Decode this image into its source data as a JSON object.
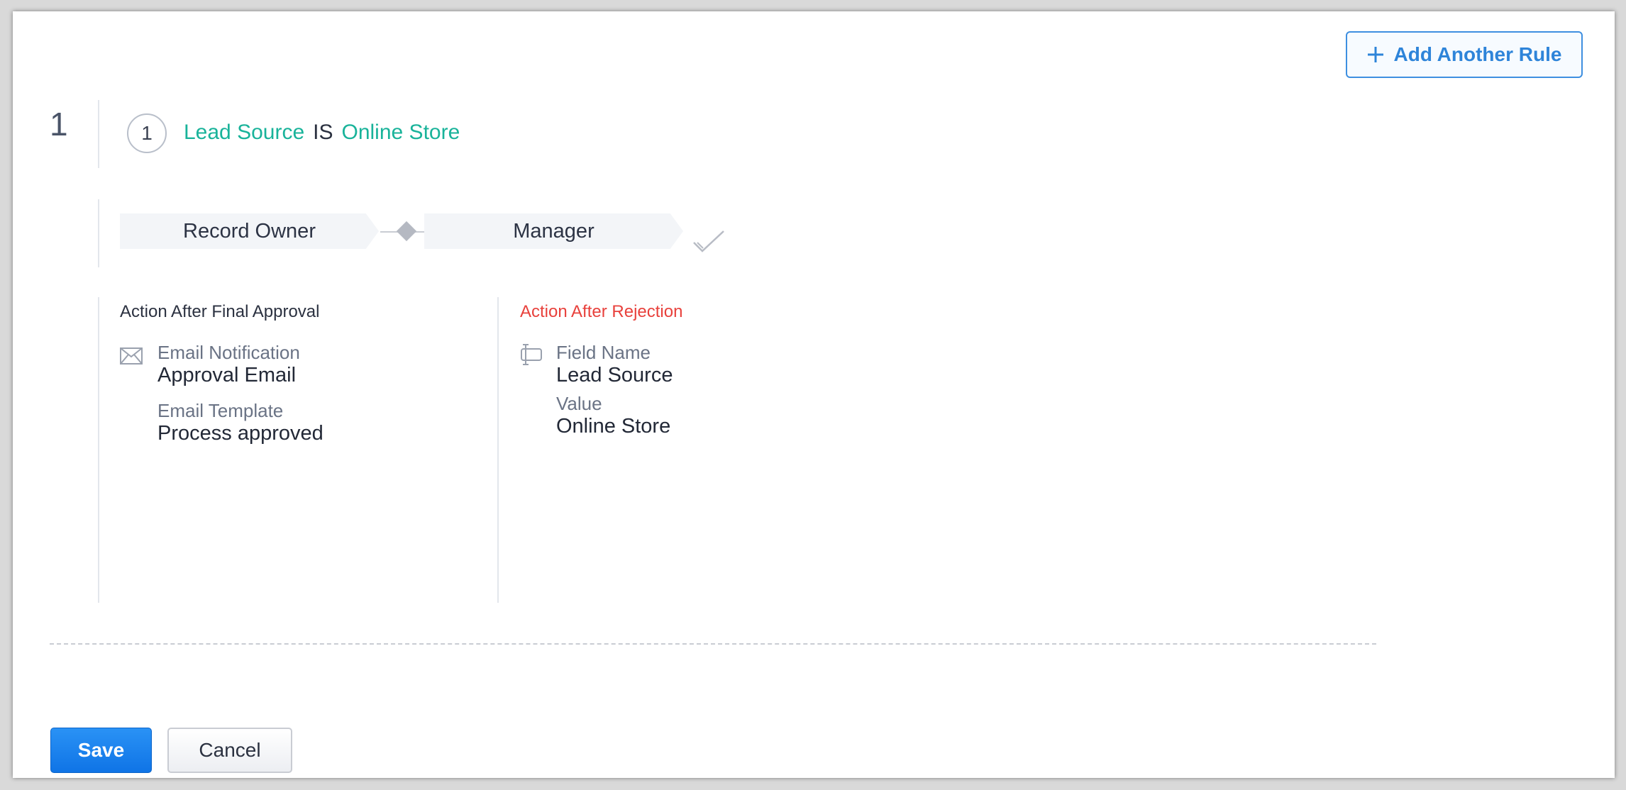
{
  "toolbar": {
    "add_rule_label": "Add Another Rule"
  },
  "rule": {
    "number": "1",
    "criteria": {
      "index": "1",
      "field": "Lead Source",
      "operator": "IS",
      "value": "Online Store"
    },
    "approvers": [
      "Record Owner",
      "Manager"
    ],
    "approval_actions": {
      "title": "Action After Final Approval",
      "type_label": "Email Notification",
      "type_value": "Approval Email",
      "template_label": "Email Template",
      "template_value": "Process approved"
    },
    "rejection_actions": {
      "title": "Action After Rejection",
      "field_label": "Field Name",
      "field_value": "Lead Source",
      "value_label": "Value",
      "value_value": "Online Store"
    }
  },
  "footer": {
    "save_label": "Save",
    "cancel_label": "Cancel"
  },
  "colors": {
    "accent_blue": "#2e84d9",
    "criteria_teal": "#19b39a",
    "rejection_red": "#e8413c",
    "save_blue": "#0f74e6"
  }
}
